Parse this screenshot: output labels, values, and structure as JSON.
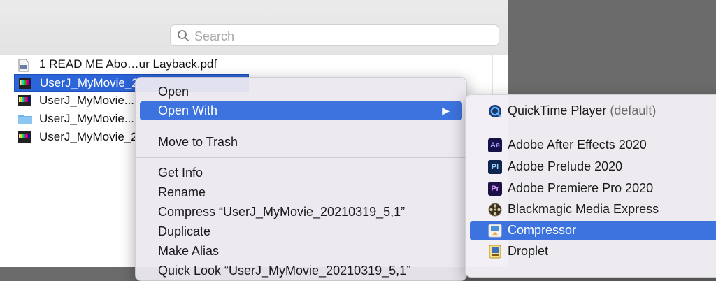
{
  "search": {
    "placeholder": "Search"
  },
  "files": [
    {
      "name": "1 READ ME Abo…ur Layback.pdf",
      "icon": "pdf-document-icon",
      "selected": false
    },
    {
      "name": "UserJ_MyMovie_2",
      "icon": "video-file-icon",
      "selected": true
    },
    {
      "name": "UserJ_MyMovie...",
      "icon": "video-file-icon",
      "selected": false
    },
    {
      "name": "UserJ_MyMovie...",
      "icon": "folder-icon",
      "selected": false
    },
    {
      "name": "UserJ_MyMovie_2",
      "icon": "video-file-icon",
      "selected": false
    }
  ],
  "context_menu": {
    "items": [
      {
        "label": "Open"
      },
      {
        "label": "Open With",
        "submenu_arrow": "▶",
        "highlighted": true
      },
      {
        "label": "Move to Trash"
      },
      {
        "label": "Get Info"
      },
      {
        "label": "Rename"
      },
      {
        "label": "Compress “UserJ_MyMovie_20210319_5,1”"
      },
      {
        "label": "Duplicate"
      },
      {
        "label": "Make Alias"
      },
      {
        "label": "Quick Look “UserJ_MyMovie_20210319_5,1”"
      }
    ]
  },
  "open_with": {
    "default_app": {
      "name": "QuickTime Player",
      "suffix": "(default)",
      "icon": "quicktime-icon"
    },
    "apps": [
      {
        "name": "Adobe After Effects 2020",
        "icon": "after-effects-icon",
        "badge": "Ae"
      },
      {
        "name": "Adobe Prelude 2020",
        "icon": "prelude-icon",
        "badge": "Pl"
      },
      {
        "name": "Adobe Premiere Pro 2020",
        "icon": "premiere-pro-icon",
        "badge": "Pr"
      },
      {
        "name": "Blackmagic Media Express",
        "icon": "film-reel-icon"
      },
      {
        "name": "Compressor",
        "icon": "compressor-icon",
        "highlighted": true
      },
      {
        "name": "Droplet",
        "icon": "droplet-icon"
      }
    ]
  },
  "colors": {
    "highlight": "#3d73de",
    "selection": "#2c64d9"
  }
}
